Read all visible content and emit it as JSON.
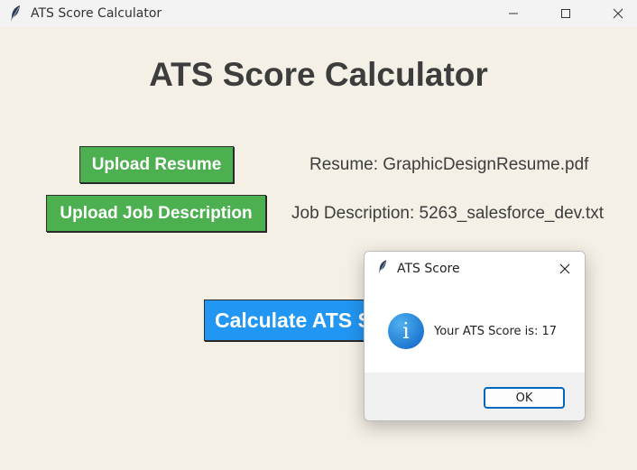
{
  "window": {
    "title": "ATS Score Calculator",
    "app_icon": "feather-icon"
  },
  "main": {
    "heading": "ATS Score Calculator",
    "upload_resume_label": "Upload Resume",
    "upload_jd_label": "Upload Job Description",
    "resume_status": "Resume: GraphicDesignResume.pdf",
    "jd_status": "Job Description: 5263_salesforce_dev.txt",
    "calculate_label": "Calculate ATS Score",
    "colors": {
      "green": "#4caf50",
      "blue": "#2196f3",
      "background": "#f5f0e6"
    }
  },
  "dialog": {
    "title": "ATS Score",
    "icon": "info-icon",
    "message": "Your ATS Score is: 17",
    "ok_label": "OK"
  }
}
